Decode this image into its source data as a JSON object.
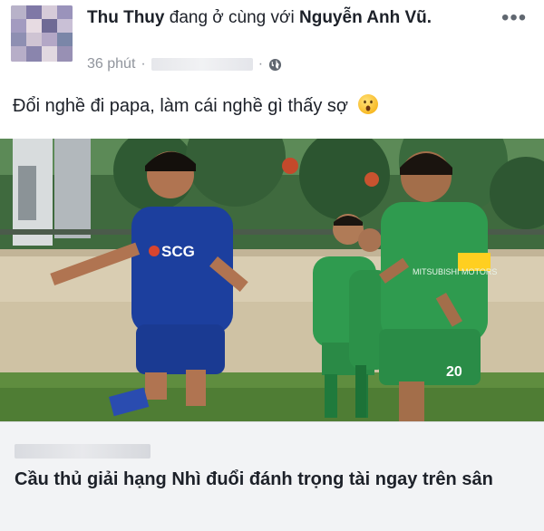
{
  "post": {
    "author": "Thu Thuy",
    "connector": "đang ở cùng với",
    "tagged": "Nguyễn Anh Vũ.",
    "time": "36 phút",
    "separator": "·",
    "separator2": "·",
    "privacy_icon": "globe-icon",
    "more_icon": "more-options-icon",
    "more_label": "•••",
    "text": "Đổi nghề đi papa, làm cái nghề gì thấy sợ",
    "emoji": "surprised-face-emoji"
  },
  "photo": {
    "banner_logo": "SCG",
    "jersey_right": "MITSUBISHI MOTORS",
    "player_number": "20"
  },
  "link": {
    "title": "Cầu thủ giải hạng Nhì đuổi đánh trọng tài ngay trên sân"
  },
  "colors": {
    "blue_kit": "#1c3f9e",
    "green_kit": "#2f9b4f",
    "text": "#1d2129",
    "meta": "#90949c",
    "card_bg": "#f2f3f5"
  }
}
